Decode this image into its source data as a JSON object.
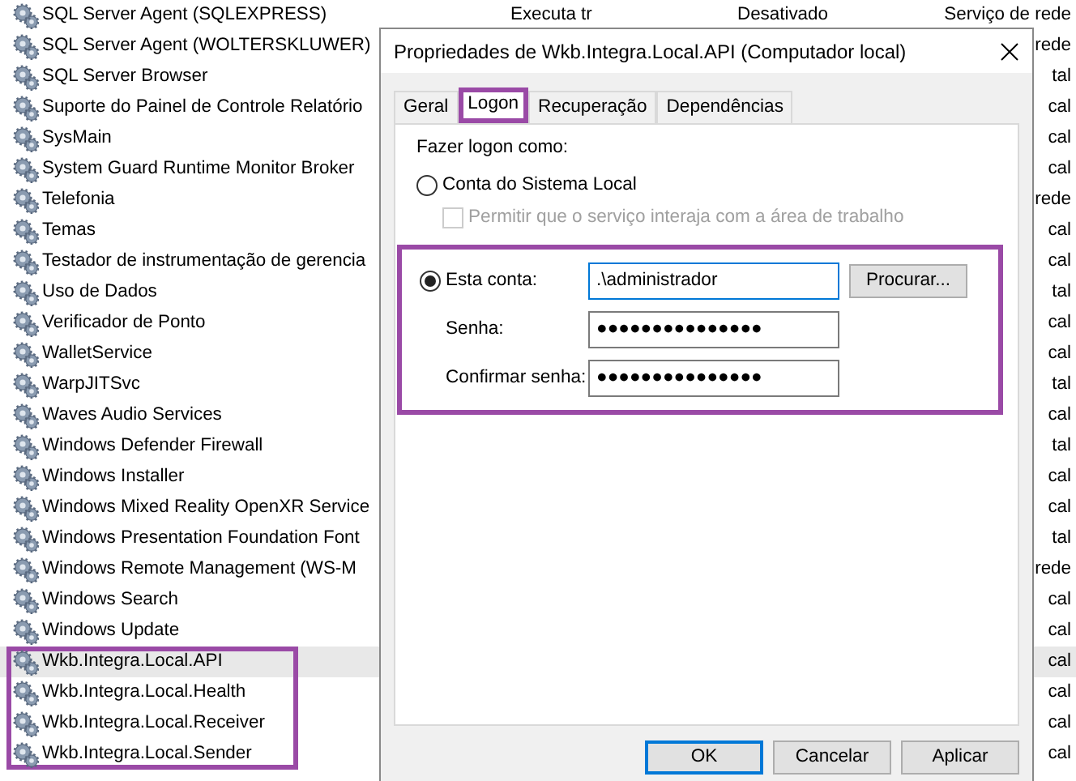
{
  "services": [
    {
      "name": "SQL Server Agent (SQLEXPRESS)",
      "status": "Executa tr",
      "startup": "Desativado",
      "logon": "Serviço de rede",
      "selected": false,
      "highlighted": false
    },
    {
      "name": "SQL Server Agent (WOLTERSKLUWER)",
      "logon": "rede",
      "selected": false,
      "highlighted": false
    },
    {
      "name": "SQL Server Browser",
      "logon": "tal",
      "selected": false,
      "highlighted": false
    },
    {
      "name": "Suporte do Painel de Controle Relatório",
      "logon": "cal",
      "selected": false,
      "highlighted": false
    },
    {
      "name": "SysMain",
      "logon": "cal",
      "selected": false,
      "highlighted": false
    },
    {
      "name": "System Guard Runtime Monitor Broker",
      "logon": "cal",
      "selected": false,
      "highlighted": false
    },
    {
      "name": "Telefonia",
      "logon": "rede",
      "selected": false,
      "highlighted": false
    },
    {
      "name": "Temas",
      "logon": "cal",
      "selected": false,
      "highlighted": false
    },
    {
      "name": "Testador de instrumentação de gerencia",
      "logon": "cal",
      "selected": false,
      "highlighted": false
    },
    {
      "name": "Uso de Dados",
      "logon": "tal",
      "selected": false,
      "highlighted": false
    },
    {
      "name": "Verificador de Ponto",
      "logon": "cal",
      "selected": false,
      "highlighted": false
    },
    {
      "name": "WalletService",
      "logon": "cal",
      "selected": false,
      "highlighted": false
    },
    {
      "name": "WarpJITSvc",
      "logon": "tal",
      "selected": false,
      "highlighted": false
    },
    {
      "name": "Waves Audio Services",
      "logon": "cal",
      "selected": false,
      "highlighted": false
    },
    {
      "name": "Windows Defender Firewall",
      "logon": "tal",
      "selected": false,
      "highlighted": false
    },
    {
      "name": "Windows Installer",
      "logon": "cal",
      "selected": false,
      "highlighted": false
    },
    {
      "name": "Windows Mixed Reality OpenXR Service",
      "logon": "cal",
      "selected": false,
      "highlighted": false
    },
    {
      "name": "Windows Presentation Foundation Font",
      "logon": "tal",
      "selected": false,
      "highlighted": false
    },
    {
      "name": "Windows Remote Management (WS-M",
      "logon": "rede",
      "selected": false,
      "highlighted": false
    },
    {
      "name": "Windows Search",
      "logon": "cal",
      "selected": false,
      "highlighted": false
    },
    {
      "name": "Windows Update",
      "logon": "cal",
      "selected": false,
      "highlighted": false
    },
    {
      "name": "Wkb.Integra.Local.API",
      "logon": "cal",
      "selected": true,
      "highlighted": true
    },
    {
      "name": "Wkb.Integra.Local.Health",
      "logon": "cal",
      "selected": false,
      "highlighted": true
    },
    {
      "name": "Wkb.Integra.Local.Receiver",
      "logon": "cal",
      "selected": false,
      "highlighted": true
    },
    {
      "name": "Wkb.Integra.Local.Sender",
      "logon": "cal",
      "selected": false,
      "highlighted": true
    }
  ],
  "dialog": {
    "title": "Propriedades de Wkb.Integra.Local.API (Computador local)",
    "tabs": [
      {
        "label": "Geral",
        "selected": false,
        "highlighted": false
      },
      {
        "label": "Logon",
        "selected": true,
        "highlighted": true
      },
      {
        "label": "Recuperação",
        "selected": false,
        "highlighted": false
      },
      {
        "label": "Dependências",
        "selected": false,
        "highlighted": false
      }
    ],
    "logon_as_label": "Fazer logon como:",
    "local_system": {
      "label": "Conta do Sistema Local",
      "selected": false
    },
    "desktop_interaction": {
      "label": "Permitir que o serviço interaja com a área de trabalho",
      "checked": false,
      "disabled": true
    },
    "account_section": {
      "highlighted": true,
      "this_account": {
        "label": "Esta conta:",
        "selected": true
      },
      "account_field": {
        "value": ".\\administrador",
        "focused": true
      },
      "browse_button": "Procurar...",
      "password_label": "Senha:",
      "password_value": "●●●●●●●●●●●●●●●",
      "confirm_label": "Confirmar senha:",
      "confirm_value": "●●●●●●●●●●●●●●●"
    },
    "buttons": [
      {
        "label": "OK",
        "default": true
      },
      {
        "label": "Cancelar",
        "default": false
      },
      {
        "label": "Aplicar",
        "default": false
      }
    ]
  }
}
